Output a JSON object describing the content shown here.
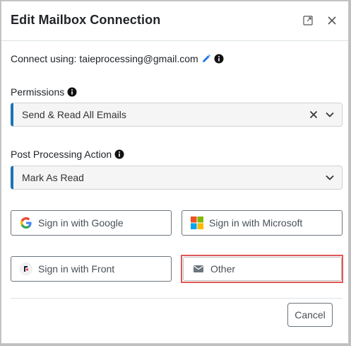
{
  "dialog": {
    "title": "Edit Mailbox Connection",
    "expand_icon": "expand-icon",
    "close_icon": "close-icon"
  },
  "connect": {
    "label": "Connect using:",
    "email": "taieprocessing@gmail.com",
    "edit_icon": "pencil-icon",
    "info_icon": "info-icon"
  },
  "permissions": {
    "label": "Permissions",
    "value": "Send & Read All Emails"
  },
  "post_processing": {
    "label": "Post Processing Action",
    "value": "Mark As Read"
  },
  "sign_in": {
    "google": "Sign in with Google",
    "microsoft": "Sign in with Microsoft",
    "front": "Sign in with Front",
    "other": "Other"
  },
  "footer": {
    "cancel": "Cancel"
  },
  "colors": {
    "accent": "#1a73b7",
    "pencil": "#1a73e8",
    "highlight": "#e05757"
  }
}
